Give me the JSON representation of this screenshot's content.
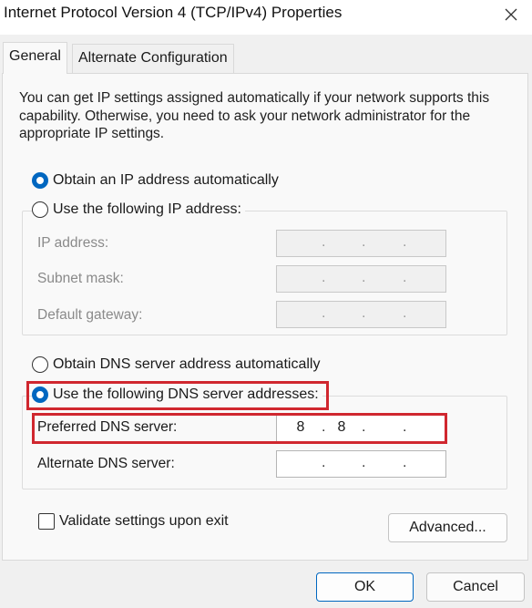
{
  "window": {
    "title": "Internet Protocol Version 4 (TCP/IPv4) Properties",
    "close_icon": "close-icon"
  },
  "tabs": [
    {
      "label": "General",
      "active": true
    },
    {
      "label": "Alternate Configuration",
      "active": false
    }
  ],
  "general": {
    "description": "You can get IP settings assigned automatically if your network supports this capability. Otherwise, you need to ask your network administrator for the appropriate IP settings.",
    "ip_mode": {
      "auto_label": "Obtain an IP address automatically",
      "manual_label": "Use the following IP address:",
      "selected": "auto"
    },
    "ip_fields": {
      "ip_address_label": "IP address:",
      "subnet_mask_label": "Subnet mask:",
      "default_gateway_label": "Default gateway:",
      "enabled": false
    },
    "dns_mode": {
      "auto_label": "Obtain DNS server address automatically",
      "manual_label": "Use the following DNS server addresses:",
      "selected": "manual"
    },
    "dns_fields": {
      "preferred_label": "Preferred DNS server:",
      "preferred_value": {
        "seg1": "8",
        "seg2": "8",
        "seg3": "",
        "seg4": ""
      },
      "alternate_label": "Alternate DNS server:",
      "alternate_value": {
        "seg1": "",
        "seg2": "",
        "seg3": "",
        "seg4": ""
      }
    },
    "validate_label": "Validate settings upon exit",
    "validate_checked": false,
    "advanced_label": "Advanced..."
  },
  "footer": {
    "ok_label": "OK",
    "cancel_label": "Cancel"
  },
  "colors": {
    "accent": "#0067c0",
    "highlight": "#d0272f"
  }
}
